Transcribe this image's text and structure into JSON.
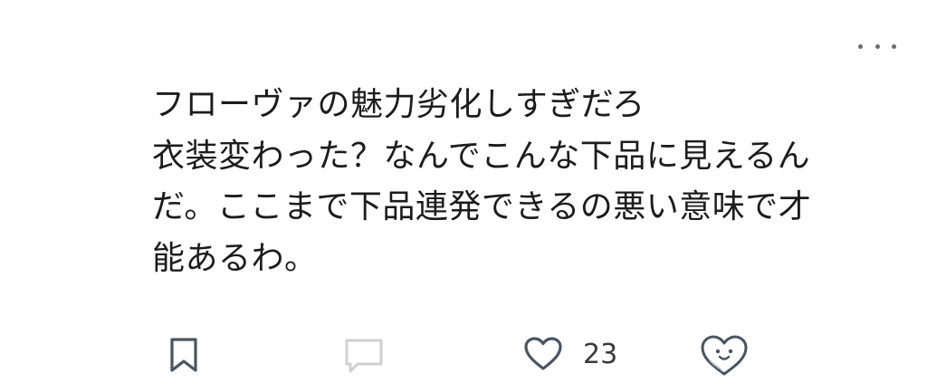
{
  "post": {
    "lines": [
      "フローヴァの魅力劣化しすぎだろ",
      "衣装変わった？なんでこんな下品に見えるん",
      "だ。ここまで下品連発できるの悪い意味で才",
      "能あるわ。"
    ]
  },
  "actions": {
    "like_count": "23"
  },
  "icons": {
    "more": "more-dots-icon",
    "bookmark": "bookmark-icon",
    "comment": "comment-icon",
    "like": "heart-icon",
    "reaction": "heart-face-icon"
  },
  "colors": {
    "text": "#1c1c1c",
    "icon": "#4a5560",
    "icon_disabled": "#d0d0d0"
  }
}
